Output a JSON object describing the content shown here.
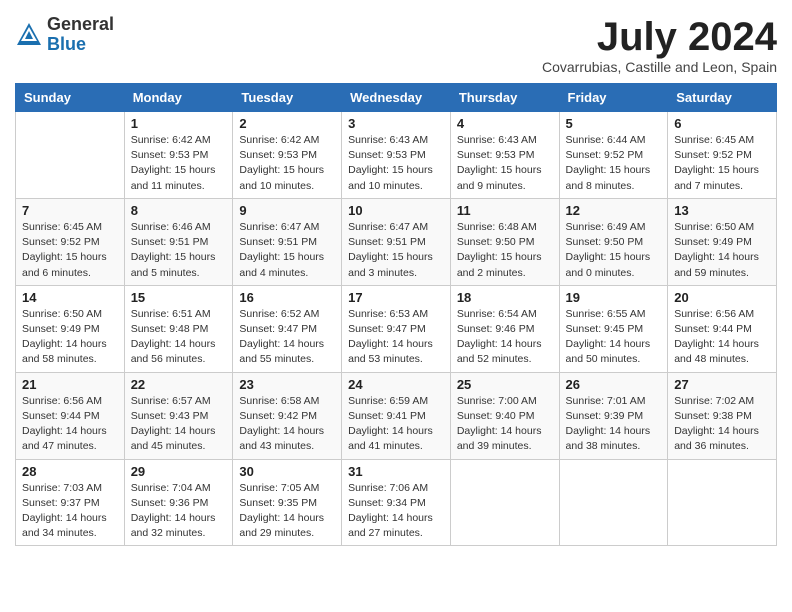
{
  "header": {
    "logo_general": "General",
    "logo_blue": "Blue",
    "month_title": "July 2024",
    "location": "Covarrubias, Castille and Leon, Spain"
  },
  "weekdays": [
    "Sunday",
    "Monday",
    "Tuesday",
    "Wednesday",
    "Thursday",
    "Friday",
    "Saturday"
  ],
  "weeks": [
    [
      {
        "day": "",
        "info": ""
      },
      {
        "day": "1",
        "info": "Sunrise: 6:42 AM\nSunset: 9:53 PM\nDaylight: 15 hours\nand 11 minutes."
      },
      {
        "day": "2",
        "info": "Sunrise: 6:42 AM\nSunset: 9:53 PM\nDaylight: 15 hours\nand 10 minutes."
      },
      {
        "day": "3",
        "info": "Sunrise: 6:43 AM\nSunset: 9:53 PM\nDaylight: 15 hours\nand 10 minutes."
      },
      {
        "day": "4",
        "info": "Sunrise: 6:43 AM\nSunset: 9:53 PM\nDaylight: 15 hours\nand 9 minutes."
      },
      {
        "day": "5",
        "info": "Sunrise: 6:44 AM\nSunset: 9:52 PM\nDaylight: 15 hours\nand 8 minutes."
      },
      {
        "day": "6",
        "info": "Sunrise: 6:45 AM\nSunset: 9:52 PM\nDaylight: 15 hours\nand 7 minutes."
      }
    ],
    [
      {
        "day": "7",
        "info": "Sunrise: 6:45 AM\nSunset: 9:52 PM\nDaylight: 15 hours\nand 6 minutes."
      },
      {
        "day": "8",
        "info": "Sunrise: 6:46 AM\nSunset: 9:51 PM\nDaylight: 15 hours\nand 5 minutes."
      },
      {
        "day": "9",
        "info": "Sunrise: 6:47 AM\nSunset: 9:51 PM\nDaylight: 15 hours\nand 4 minutes."
      },
      {
        "day": "10",
        "info": "Sunrise: 6:47 AM\nSunset: 9:51 PM\nDaylight: 15 hours\nand 3 minutes."
      },
      {
        "day": "11",
        "info": "Sunrise: 6:48 AM\nSunset: 9:50 PM\nDaylight: 15 hours\nand 2 minutes."
      },
      {
        "day": "12",
        "info": "Sunrise: 6:49 AM\nSunset: 9:50 PM\nDaylight: 15 hours\nand 0 minutes."
      },
      {
        "day": "13",
        "info": "Sunrise: 6:50 AM\nSunset: 9:49 PM\nDaylight: 14 hours\nand 59 minutes."
      }
    ],
    [
      {
        "day": "14",
        "info": "Sunrise: 6:50 AM\nSunset: 9:49 PM\nDaylight: 14 hours\nand 58 minutes."
      },
      {
        "day": "15",
        "info": "Sunrise: 6:51 AM\nSunset: 9:48 PM\nDaylight: 14 hours\nand 56 minutes."
      },
      {
        "day": "16",
        "info": "Sunrise: 6:52 AM\nSunset: 9:47 PM\nDaylight: 14 hours\nand 55 minutes."
      },
      {
        "day": "17",
        "info": "Sunrise: 6:53 AM\nSunset: 9:47 PM\nDaylight: 14 hours\nand 53 minutes."
      },
      {
        "day": "18",
        "info": "Sunrise: 6:54 AM\nSunset: 9:46 PM\nDaylight: 14 hours\nand 52 minutes."
      },
      {
        "day": "19",
        "info": "Sunrise: 6:55 AM\nSunset: 9:45 PM\nDaylight: 14 hours\nand 50 minutes."
      },
      {
        "day": "20",
        "info": "Sunrise: 6:56 AM\nSunset: 9:44 PM\nDaylight: 14 hours\nand 48 minutes."
      }
    ],
    [
      {
        "day": "21",
        "info": "Sunrise: 6:56 AM\nSunset: 9:44 PM\nDaylight: 14 hours\nand 47 minutes."
      },
      {
        "day": "22",
        "info": "Sunrise: 6:57 AM\nSunset: 9:43 PM\nDaylight: 14 hours\nand 45 minutes."
      },
      {
        "day": "23",
        "info": "Sunrise: 6:58 AM\nSunset: 9:42 PM\nDaylight: 14 hours\nand 43 minutes."
      },
      {
        "day": "24",
        "info": "Sunrise: 6:59 AM\nSunset: 9:41 PM\nDaylight: 14 hours\nand 41 minutes."
      },
      {
        "day": "25",
        "info": "Sunrise: 7:00 AM\nSunset: 9:40 PM\nDaylight: 14 hours\nand 39 minutes."
      },
      {
        "day": "26",
        "info": "Sunrise: 7:01 AM\nSunset: 9:39 PM\nDaylight: 14 hours\nand 38 minutes."
      },
      {
        "day": "27",
        "info": "Sunrise: 7:02 AM\nSunset: 9:38 PM\nDaylight: 14 hours\nand 36 minutes."
      }
    ],
    [
      {
        "day": "28",
        "info": "Sunrise: 7:03 AM\nSunset: 9:37 PM\nDaylight: 14 hours\nand 34 minutes."
      },
      {
        "day": "29",
        "info": "Sunrise: 7:04 AM\nSunset: 9:36 PM\nDaylight: 14 hours\nand 32 minutes."
      },
      {
        "day": "30",
        "info": "Sunrise: 7:05 AM\nSunset: 9:35 PM\nDaylight: 14 hours\nand 29 minutes."
      },
      {
        "day": "31",
        "info": "Sunrise: 7:06 AM\nSunset: 9:34 PM\nDaylight: 14 hours\nand 27 minutes."
      },
      {
        "day": "",
        "info": ""
      },
      {
        "day": "",
        "info": ""
      },
      {
        "day": "",
        "info": ""
      }
    ]
  ]
}
